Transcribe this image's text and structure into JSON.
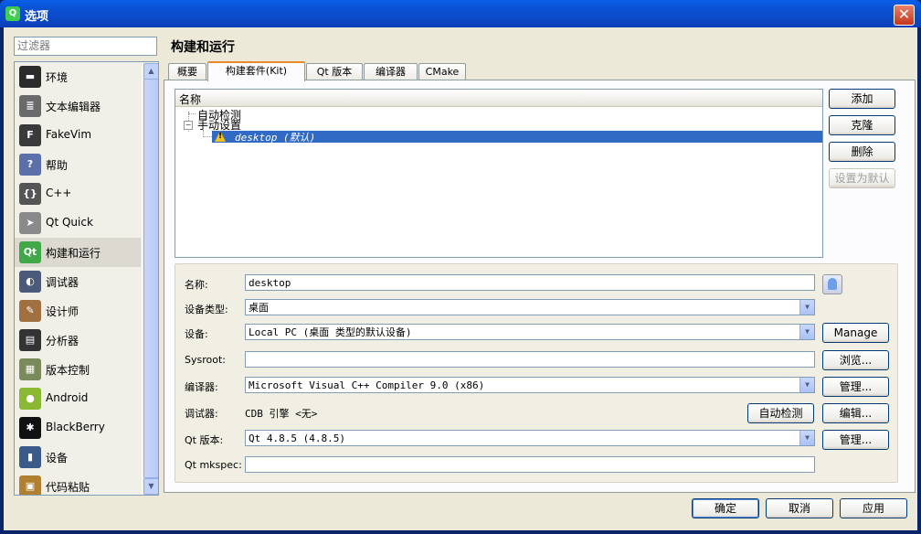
{
  "window": {
    "title": "选项",
    "app_icon": "qt-logo-icon",
    "close_label": "✕"
  },
  "filter": {
    "placeholder": "过滤器",
    "value": ""
  },
  "sidebar": {
    "items": [
      {
        "label": "环境",
        "icon": "monitor-icon",
        "color": "#2b2b2b"
      },
      {
        "label": "文本编辑器",
        "icon": "text-editor-icon",
        "color": "#6a6a6a"
      },
      {
        "label": "FakeVim",
        "icon": "fakevim-icon",
        "color": "#3a3a3a"
      },
      {
        "label": "帮助",
        "icon": "help-icon",
        "color": "#5b6fa8"
      },
      {
        "label": "C++",
        "icon": "braces-icon",
        "color": "#555555"
      },
      {
        "label": "Qt Quick",
        "icon": "paper-plane-icon",
        "color": "#8a8a8a"
      },
      {
        "label": "构建和运行",
        "icon": "build-run-icon",
        "color": "#41a84a"
      },
      {
        "label": "调试器",
        "icon": "debugger-icon",
        "color": "#4a5a78"
      },
      {
        "label": "设计师",
        "icon": "designer-icon",
        "color": "#a07040"
      },
      {
        "label": "分析器",
        "icon": "analyzer-icon",
        "color": "#333333"
      },
      {
        "label": "版本控制",
        "icon": "version-control-icon",
        "color": "#7a8a5a"
      },
      {
        "label": "Android",
        "icon": "android-icon",
        "color": "#8ab832"
      },
      {
        "label": "BlackBerry",
        "icon": "blackberry-icon",
        "color": "#111111"
      },
      {
        "label": "设备",
        "icon": "device-icon",
        "color": "#3a5a88"
      },
      {
        "label": "代码粘贴",
        "icon": "paste-icon",
        "color": "#b08030"
      }
    ],
    "selected_index": 6
  },
  "page": {
    "title": "构建和运行"
  },
  "tabs": [
    {
      "label": "概要"
    },
    {
      "label": "构建套件(Kit)"
    },
    {
      "label": "Qt 版本"
    },
    {
      "label": "编译器"
    },
    {
      "label": "CMake"
    }
  ],
  "kit_tree": {
    "header": "名称",
    "auto_detected": "自动检测",
    "manual": "手动设置",
    "selected_kit": "desktop (默认)",
    "expander_label": "−"
  },
  "kit_buttons": {
    "add": "添加",
    "clone": "克隆",
    "remove": "删除",
    "set_default": "设置为默认"
  },
  "form": {
    "name_label": "名称:",
    "name_value": "desktop",
    "device_type_label": "设备类型:",
    "device_type_value": "桌面",
    "device_label": "设备:",
    "device_value": "Local PC (桌面 类型的默认设备)",
    "device_manage": "Manage",
    "sysroot_label": "Sysroot:",
    "sysroot_value": "",
    "sysroot_browse": "浏览...",
    "compiler_label": "编译器:",
    "compiler_value": "Microsoft Visual C++ Compiler 9.0 (x86)",
    "compiler_manage": "管理...",
    "debugger_label": "调试器:",
    "debugger_value": "CDB 引擎 <无>",
    "debugger_autodetect": "自动检测",
    "debugger_edit": "编辑...",
    "qt_version_label": "Qt 版本:",
    "qt_version_value": "Qt 4.8.5 (4.8.5)",
    "qt_version_manage": "管理...",
    "mkspec_label": "Qt mkspec:",
    "mkspec_value": ""
  },
  "dialog_buttons": {
    "ok": "确定",
    "cancel": "取消",
    "apply": "应用"
  }
}
